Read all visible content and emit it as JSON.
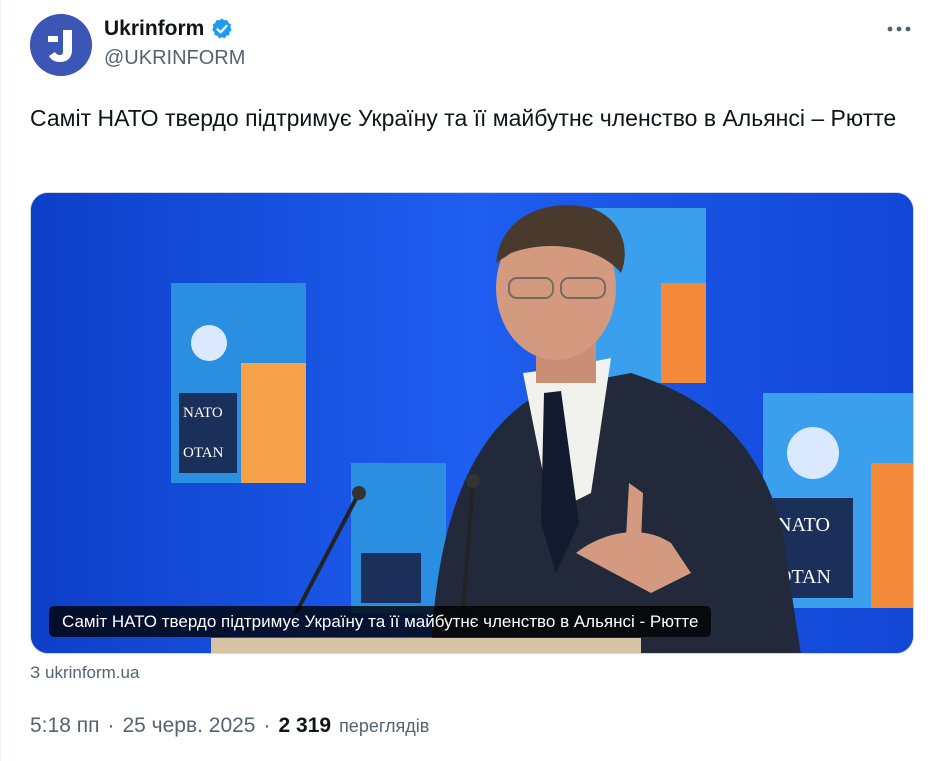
{
  "author": {
    "display_name": "Ukrinform",
    "handle": "@UKRINFORM",
    "verified_icon": "verified-badge-icon",
    "brand_color": "#3b56b5",
    "badge_color": "#1d9bf0"
  },
  "more_icon": "more-horizontal-icon",
  "tweet": {
    "text": "Саміт НАТО твердо підтримує Україну та її майбутнє членство в Альянсі – Рютте"
  },
  "media": {
    "caption": "Саміт НАТО твердо підтримує Україну та її майбутнє членство в Альянсі - Рютте",
    "poster_text_nato": "NATO",
    "poster_text_otan": "OTAN"
  },
  "link_source": "З ukrinform.ua",
  "meta": {
    "time": "5:18 пп",
    "date": "25 черв. 2025",
    "separator": "·",
    "views_count": "2 319",
    "views_label": "переглядів"
  }
}
